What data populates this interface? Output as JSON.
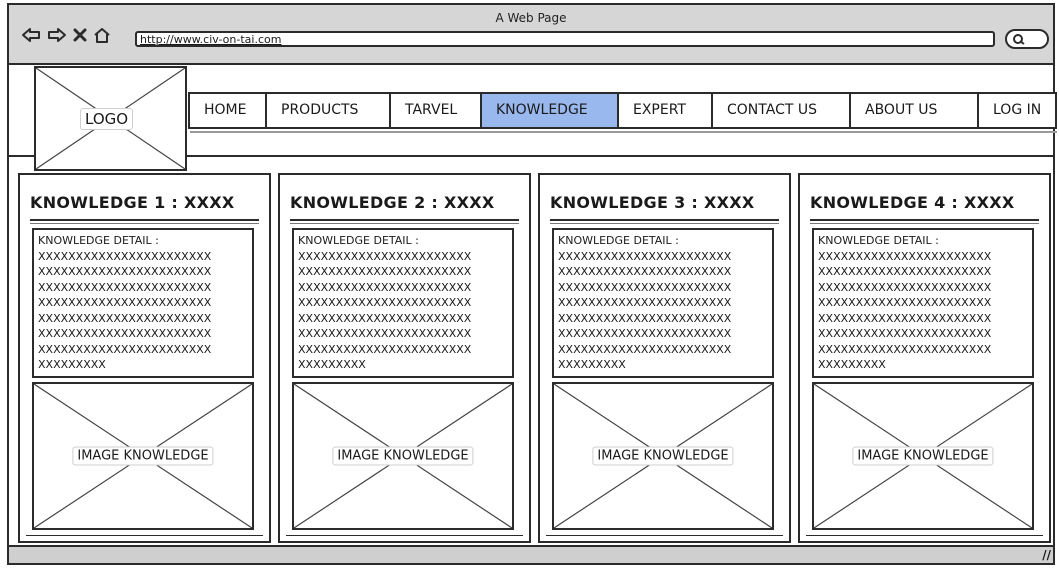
{
  "window": {
    "title": "A Web Page"
  },
  "browser": {
    "url": "http://www.civ-on-tai.com",
    "icons": [
      "back-arrow-icon",
      "forward-arrow-icon",
      "close-icon",
      "home-icon",
      "search-icon"
    ]
  },
  "header": {
    "logo_label": "LOGO",
    "menu": [
      {
        "label": "HOME",
        "active": false
      },
      {
        "label": "PRODUCTS",
        "active": false
      },
      {
        "label": "TARVEL",
        "active": false
      },
      {
        "label": "KNOWLEDGE",
        "active": true
      },
      {
        "label": "EXPERT",
        "active": false
      },
      {
        "label": "CONTACT US",
        "active": false
      },
      {
        "label": "ABOUT US",
        "active": false
      },
      {
        "label": "LOG IN",
        "active": false
      }
    ],
    "active_color": "#99b8ee"
  },
  "cards": [
    {
      "title": "KNOWLEDGE 1 : XXXX",
      "detail_label": "KNOWLEDGE DETAIL :",
      "detail_text": "XXXXXXXXXXXXXXXXXXXXXXX\nXXXXXXXXXXXXXXXXXXXXXXX\nXXXXXXXXXXXXXXXXXXXXXXX\nXXXXXXXXXXXXXXXXXXXXXXX\nXXXXXXXXXXXXXXXXXXXXXXX\nXXXXXXXXXXXXXXXXXXXXXXX\nXXXXXXXXXXXXXXXXXXXXXXX\nXXXXXXXXX",
      "image_label": "IMAGE KNOWLEDGE"
    },
    {
      "title": "KNOWLEDGE 2 : XXXX",
      "detail_label": "KNOWLEDGE DETAIL :",
      "detail_text": "XXXXXXXXXXXXXXXXXXXXXXX\nXXXXXXXXXXXXXXXXXXXXXXX\nXXXXXXXXXXXXXXXXXXXXXXX\nXXXXXXXXXXXXXXXXXXXXXXX\nXXXXXXXXXXXXXXXXXXXXXXX\nXXXXXXXXXXXXXXXXXXXXXXX\nXXXXXXXXXXXXXXXXXXXXXXX\nXXXXXXXXX",
      "image_label": "IMAGE KNOWLEDGE"
    },
    {
      "title": "KNOWLEDGE 3 : XXXX",
      "detail_label": "KNOWLEDGE DETAIL :",
      "detail_text": "XXXXXXXXXXXXXXXXXXXXXXX\nXXXXXXXXXXXXXXXXXXXXXXX\nXXXXXXXXXXXXXXXXXXXXXXX\nXXXXXXXXXXXXXXXXXXXXXXX\nXXXXXXXXXXXXXXXXXXXXXXX\nXXXXXXXXXXXXXXXXXXXXXXX\nXXXXXXXXXXXXXXXXXXXXXXX\nXXXXXXXXX",
      "image_label": "IMAGE KNOWLEDGE"
    },
    {
      "title": "KNOWLEDGE 4 : XXXX",
      "detail_label": "KNOWLEDGE DETAIL :",
      "detail_text": "XXXXXXXXXXXXXXXXXXXXXXX\nXXXXXXXXXXXXXXXXXXXXXXX\nXXXXXXXXXXXXXXXXXXXXXXX\nXXXXXXXXXXXXXXXXXXXXXXX\nXXXXXXXXXXXXXXXXXXXXXXX\nXXXXXXXXXXXXXXXXXXXXXXX\nXXXXXXXXXXXXXXXXXXXXXXX\nXXXXXXXXX",
      "image_label": "IMAGE KNOWLEDGE"
    }
  ],
  "status_bar": {
    "grip_icon": "resize-grip-icon"
  }
}
